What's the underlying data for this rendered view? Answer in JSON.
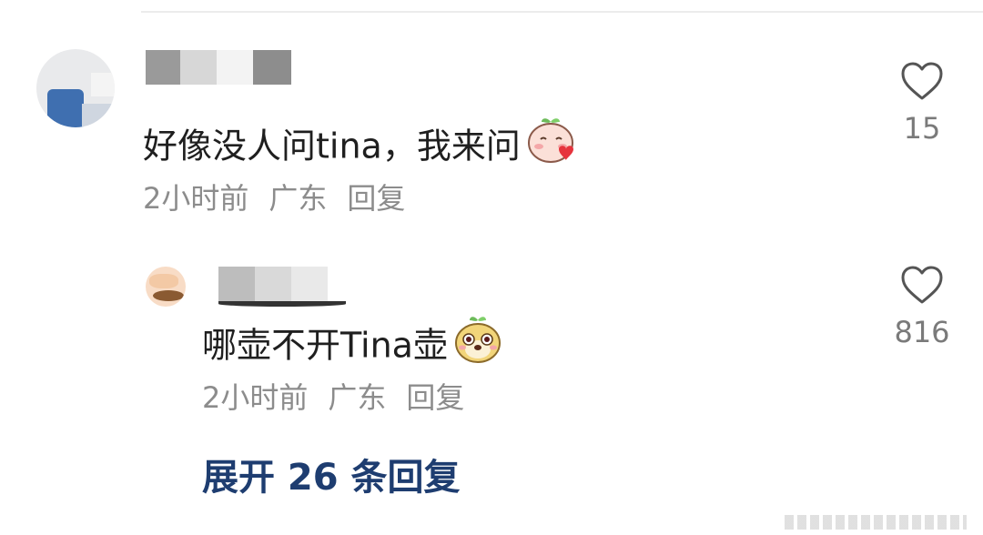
{
  "comments": [
    {
      "text": "好像没人问tina，我来问",
      "emoji": "blushing-peach-emoji",
      "time": "2小时前",
      "location": "广东",
      "reply_label": "回复",
      "likes": "15"
    },
    {
      "text": "哪壶不开Tina壶",
      "emoji": "dog-face-emoji",
      "time": "2小时前",
      "location": "广东",
      "reply_label": "回复",
      "likes": "816"
    }
  ],
  "expand_replies_label": "展开 26 条回复",
  "icons": {
    "like": "heart-outline-icon"
  },
  "colors": {
    "link": "#1e3d70",
    "meta": "#8c8c8c",
    "text": "#1f1f1f"
  }
}
